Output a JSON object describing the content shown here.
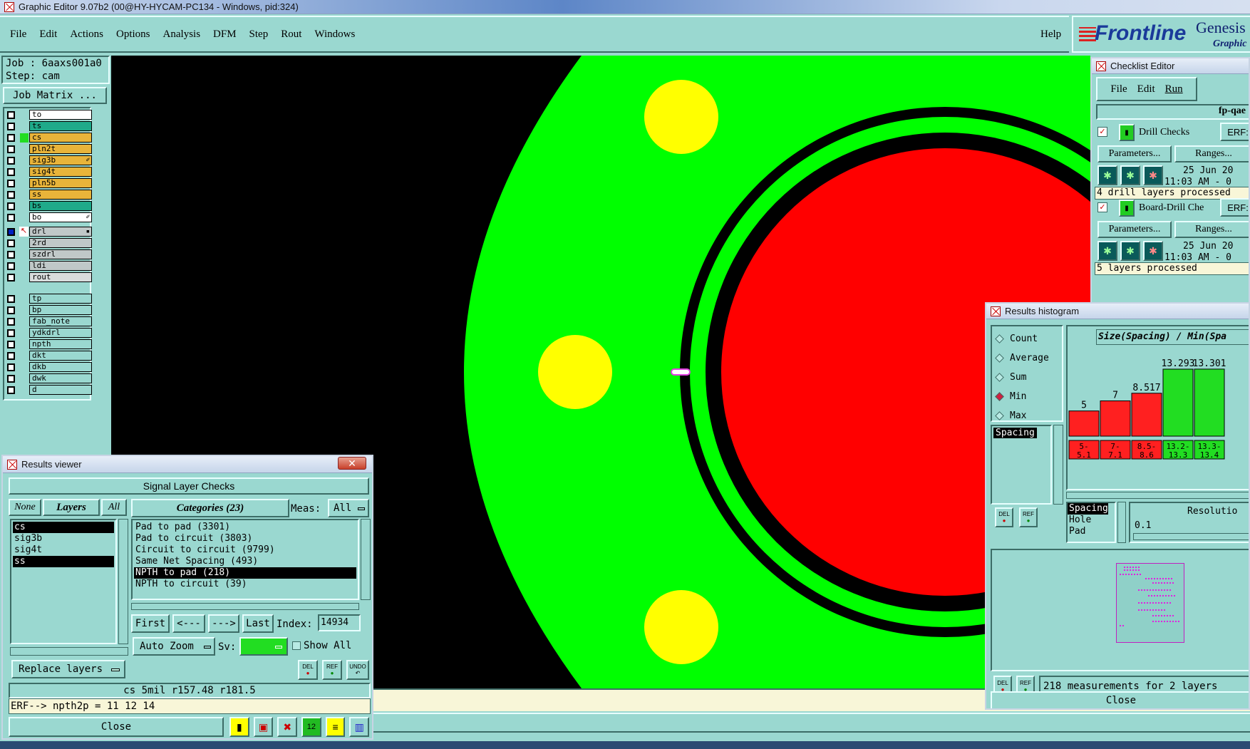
{
  "window": {
    "title": "Graphic Editor 9.07b2 (00@HY-HYCAM-PC134 - Windows, pid:324)"
  },
  "menu": {
    "items": [
      "File",
      "Edit",
      "Actions",
      "Options",
      "Analysis",
      "DFM",
      "Step",
      "Rout",
      "Windows"
    ],
    "help": "Help"
  },
  "brand": {
    "logo": "Frontline",
    "product": "Genesis",
    "subtitle": "Graphic"
  },
  "job": {
    "job": "Job : 6aaxs001a0",
    "step": "Step: cam",
    "matrix_button": "Job Matrix ..."
  },
  "layers": {
    "group1": [
      {
        "name": "to",
        "color": "#ffffff",
        "mark": ""
      },
      {
        "name": "ts",
        "color": "#1faa8a",
        "mark": ""
      },
      {
        "name": "cs",
        "color": "#e8b43a",
        "mark": ""
      },
      {
        "name": "pln2t",
        "color": "#e8b43a",
        "mark": ""
      },
      {
        "name": "sig3b",
        "color": "#e8b43a",
        "mark": "✐"
      },
      {
        "name": "sig4t",
        "color": "#e8b43a",
        "mark": ""
      },
      {
        "name": "pln5b",
        "color": "#e8b43a",
        "mark": ""
      },
      {
        "name": "ss",
        "color": "#e8b43a",
        "mark": ""
      },
      {
        "name": "bs",
        "color": "#1faa8a",
        "mark": ""
      },
      {
        "name": "bo",
        "color": "#ffffff",
        "mark": "✐"
      }
    ],
    "group2": [
      {
        "name": "drl",
        "color": "#c0c8c8",
        "mark": "▪"
      },
      {
        "name": "2rd",
        "color": "#c0c8c8",
        "mark": ""
      },
      {
        "name": "szdrl",
        "color": "#c0c8c8",
        "mark": ""
      },
      {
        "name": "ldi",
        "color": "#c0c8c8",
        "mark": ""
      },
      {
        "name": "rout",
        "color": "#d8dcdc",
        "mark": ""
      }
    ],
    "group3": [
      {
        "name": "tp",
        "color": "#9ad8d0",
        "mark": ""
      },
      {
        "name": "bp",
        "color": "#9ad8d0",
        "mark": ""
      },
      {
        "name": "fab_note",
        "color": "#9ad8d0",
        "mark": ""
      },
      {
        "name": "ydkdrl",
        "color": "#9ad8d0",
        "mark": ""
      },
      {
        "name": "npth",
        "color": "#9ad8d0",
        "mark": ""
      },
      {
        "name": "dkt",
        "color": "#9ad8d0",
        "mark": ""
      },
      {
        "name": "dkb",
        "color": "#9ad8d0",
        "mark": ""
      },
      {
        "name": "dwk",
        "color": "#9ad8d0",
        "mark": ""
      },
      {
        "name": "d",
        "color": "#9ad8d0",
        "mark": ""
      }
    ]
  },
  "checklist": {
    "title": "Checklist Editor",
    "menu": [
      "File",
      "Edit",
      "Run"
    ],
    "name": "fp-qae",
    "checks": [
      {
        "name": "Drill Checks",
        "erf": "ERF:",
        "params": "Parameters...",
        "ranges": "Ranges...",
        "date": "25 Jun 20",
        "time": "11:03 AM - 0",
        "status": "4 drill layers processed"
      },
      {
        "name": "Board-Drill Che",
        "erf": "ERF:",
        "params": "Parameters...",
        "ranges": "Ranges...",
        "date": "25 Jun 20",
        "time": "11:03 AM - 0",
        "status": "5 layers processed"
      }
    ]
  },
  "results_viewer": {
    "title": "Results viewer",
    "header": "Signal Layer Checks",
    "none": "None",
    "layers_tab": "Layers",
    "all": "All",
    "categories_label": "Categories (23)",
    "meas_label": "Meas:",
    "meas_value": "All",
    "layer_list": [
      {
        "name": "cs",
        "selected": true
      },
      {
        "name": "sig3b",
        "selected": false
      },
      {
        "name": "sig4t",
        "selected": false
      },
      {
        "name": "ss",
        "selected": true
      }
    ],
    "categories": [
      {
        "name": "Pad to pad (3301)",
        "selected": false
      },
      {
        "name": "Pad to circuit (3803)",
        "selected": false
      },
      {
        "name": "Circuit to circuit (9799)",
        "selected": false
      },
      {
        "name": "Same Net Spacing (493)",
        "selected": false
      },
      {
        "name": "NPTH to pad (218)",
        "selected": true
      },
      {
        "name": "NPTH to circuit (39)",
        "selected": false
      }
    ],
    "nav": {
      "first": "First",
      "prev": "<---",
      "next": "--->",
      "last": "Last",
      "index_label": "Index:",
      "index_value": "14934"
    },
    "auto_zoom": "Auto Zoom",
    "sv_label": "Sv:",
    "show_all": "Show All",
    "replace_layers": "Replace layers",
    "del": "DEL",
    "ref": "REF",
    "undo": "UNDO",
    "info": "cs 5mil  r157.48  r181.5",
    "erf": "ERF--> npth2p = 11 12 14",
    "close": "Close"
  },
  "histogram": {
    "title": "Results histogram",
    "modes": [
      {
        "label": "Count",
        "selected": false
      },
      {
        "label": "Average",
        "selected": false
      },
      {
        "label": "Sum",
        "selected": false
      },
      {
        "label": "Min",
        "selected": true
      },
      {
        "label": "Max",
        "selected": false
      }
    ],
    "list_item": "Spacing",
    "chart_title": "Size(Spacing) / Min(Spa",
    "measures": [
      "Spacing",
      "Hole",
      "Pad"
    ],
    "resolution_label": "Resolutio",
    "resolution_value": "0.1",
    "del": "DEL",
    "ref": "REF",
    "summary": "218 measurements for 2 layers",
    "close": "Close"
  },
  "chart_data": {
    "type": "bar",
    "title": "Size(Spacing) / Min(Spa",
    "categories": [
      "5-\n5.1",
      "7-\n7.1",
      "8.5-\n8.6",
      "13.2-\n13.3",
      "13.3-\n13.4"
    ],
    "values": [
      5,
      7,
      8.517,
      13.293,
      13.301
    ],
    "labels": [
      "5",
      "7",
      "8.517",
      "13.293",
      "13.301"
    ],
    "colors": [
      "#ff2020",
      "#ff2020",
      "#ff2020",
      "#22dd22",
      "#22dd22"
    ],
    "ylim": [
      0,
      15
    ]
  },
  "colors": {
    "canvas_bg": "#000000",
    "copper": "#00ff00",
    "hole": "#ff0000",
    "pad": "#ffff00",
    "ui": "#9ad8d0"
  }
}
